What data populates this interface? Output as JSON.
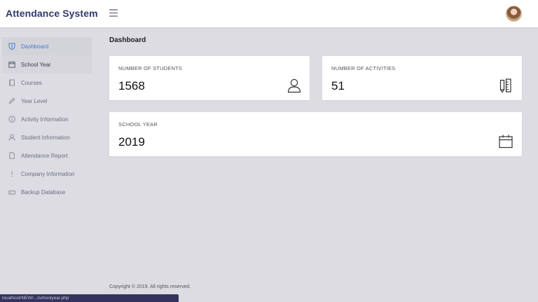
{
  "app": {
    "title": "Attendance System"
  },
  "header": {
    "menu_icon": "menu-icon",
    "avatar_icon": "user-avatar"
  },
  "sidebar": {
    "items": [
      {
        "label": "Dashboard",
        "icon": "shield-icon",
        "state": "active"
      },
      {
        "label": "School Year",
        "icon": "calendar-icon",
        "state": "hover"
      },
      {
        "label": "Courses",
        "icon": "book-icon",
        "state": ""
      },
      {
        "label": "Year Level",
        "icon": "pencil-icon",
        "state": ""
      },
      {
        "label": "Activity Information",
        "icon": "info-icon",
        "state": ""
      },
      {
        "label": "Student Information",
        "icon": "user-icon",
        "state": ""
      },
      {
        "label": "Attendance Report",
        "icon": "document-icon",
        "state": ""
      },
      {
        "label": "Company Information",
        "icon": "exclamation-icon",
        "state": ""
      },
      {
        "label": "Backup Database",
        "icon": "drive-icon",
        "state": ""
      }
    ]
  },
  "main": {
    "title": "Dashboard",
    "cards": [
      {
        "label": "NUMBER OF STUDENTS",
        "value": "1568",
        "icon": "user-icon"
      },
      {
        "label": "NUMBER OF ACTIVITIES",
        "value": "51",
        "icon": "ruler-pencil-icon"
      },
      {
        "label": "SCHOOL YEAR",
        "value": "2019",
        "icon": "calendar-icon"
      }
    ]
  },
  "footer": {
    "text": "Copyright © 2019. All rights reserved."
  },
  "statusbar": {
    "url": "localhost/NEW/.../schoolyear.php"
  },
  "colors": {
    "brand": "#2f3a6e",
    "active": "#4a7bd0",
    "background": "#dcdce2",
    "statusbar": "#35335e"
  }
}
